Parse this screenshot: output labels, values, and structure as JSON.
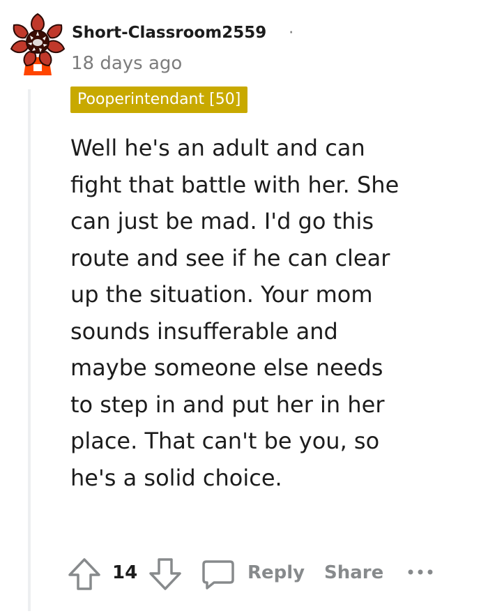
{
  "comment": {
    "username": "Short-Classroom2559",
    "separator": "·",
    "timestamp": "18 days ago",
    "flair": "Pooperintendant [50]",
    "body": "Well he's an adult and can fight that battle with her. She can just be mad. I'd go this route and see if he can clear up the situation. Your mom sounds insufferable and maybe someone else needs to step in and put her in her place. That can't be you, so he's a solid choice."
  },
  "actions": {
    "score": "14",
    "reply_label": "Reply",
    "share_label": "Share",
    "icons": [
      "upvote-arrow-icon",
      "downvote-arrow-icon",
      "comment-bubble-icon",
      "more-options-icon"
    ]
  },
  "colors": {
    "flair_background": "#c8a900",
    "action_gray": "#878a8c",
    "meta_gray": "#7c7c7c",
    "thread_line": "#edeff1",
    "avatar_red": "#c0392b",
    "avatar_orange": "#ff4500"
  }
}
